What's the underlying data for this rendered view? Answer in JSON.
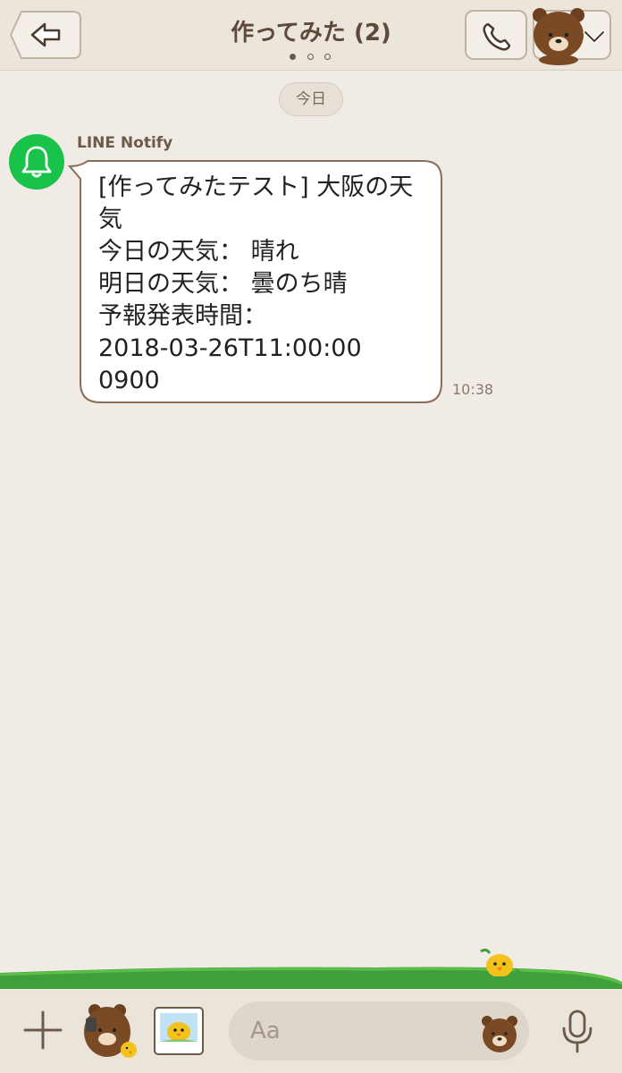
{
  "header": {
    "back_icon": "back-arrow-icon",
    "title": "作ってみた (2)",
    "call_icon": "phone-icon",
    "menu_icon": "chevron-down-icon",
    "page_dots": 3,
    "active_dot": 0
  },
  "chat": {
    "date_label": "今日",
    "messages": [
      {
        "sender": "LINE Notify",
        "avatar_icon": "bell-icon",
        "lines": [
          "[作ってみたテスト] 大阪の天",
          "気",
          "今日の天気： 晴れ",
          "明日の天気： 曇のち晴",
          "予報発表時間：",
          "2018-03-26T11:00:00",
          "0900"
        ],
        "time": "10:38"
      }
    ]
  },
  "input_bar": {
    "plus_icon": "plus-icon",
    "sticker_icon": "bear-sticker-icon",
    "photo_icon": "photo-icon",
    "placeholder": "Aa",
    "emoji_icon": "bear-emoji-icon",
    "mic_icon": "microphone-icon"
  },
  "colors": {
    "background": "#f0ebe4",
    "header": "#ece5db",
    "accent_green": "#19c34a",
    "title_brown": "#5c4a3b"
  }
}
